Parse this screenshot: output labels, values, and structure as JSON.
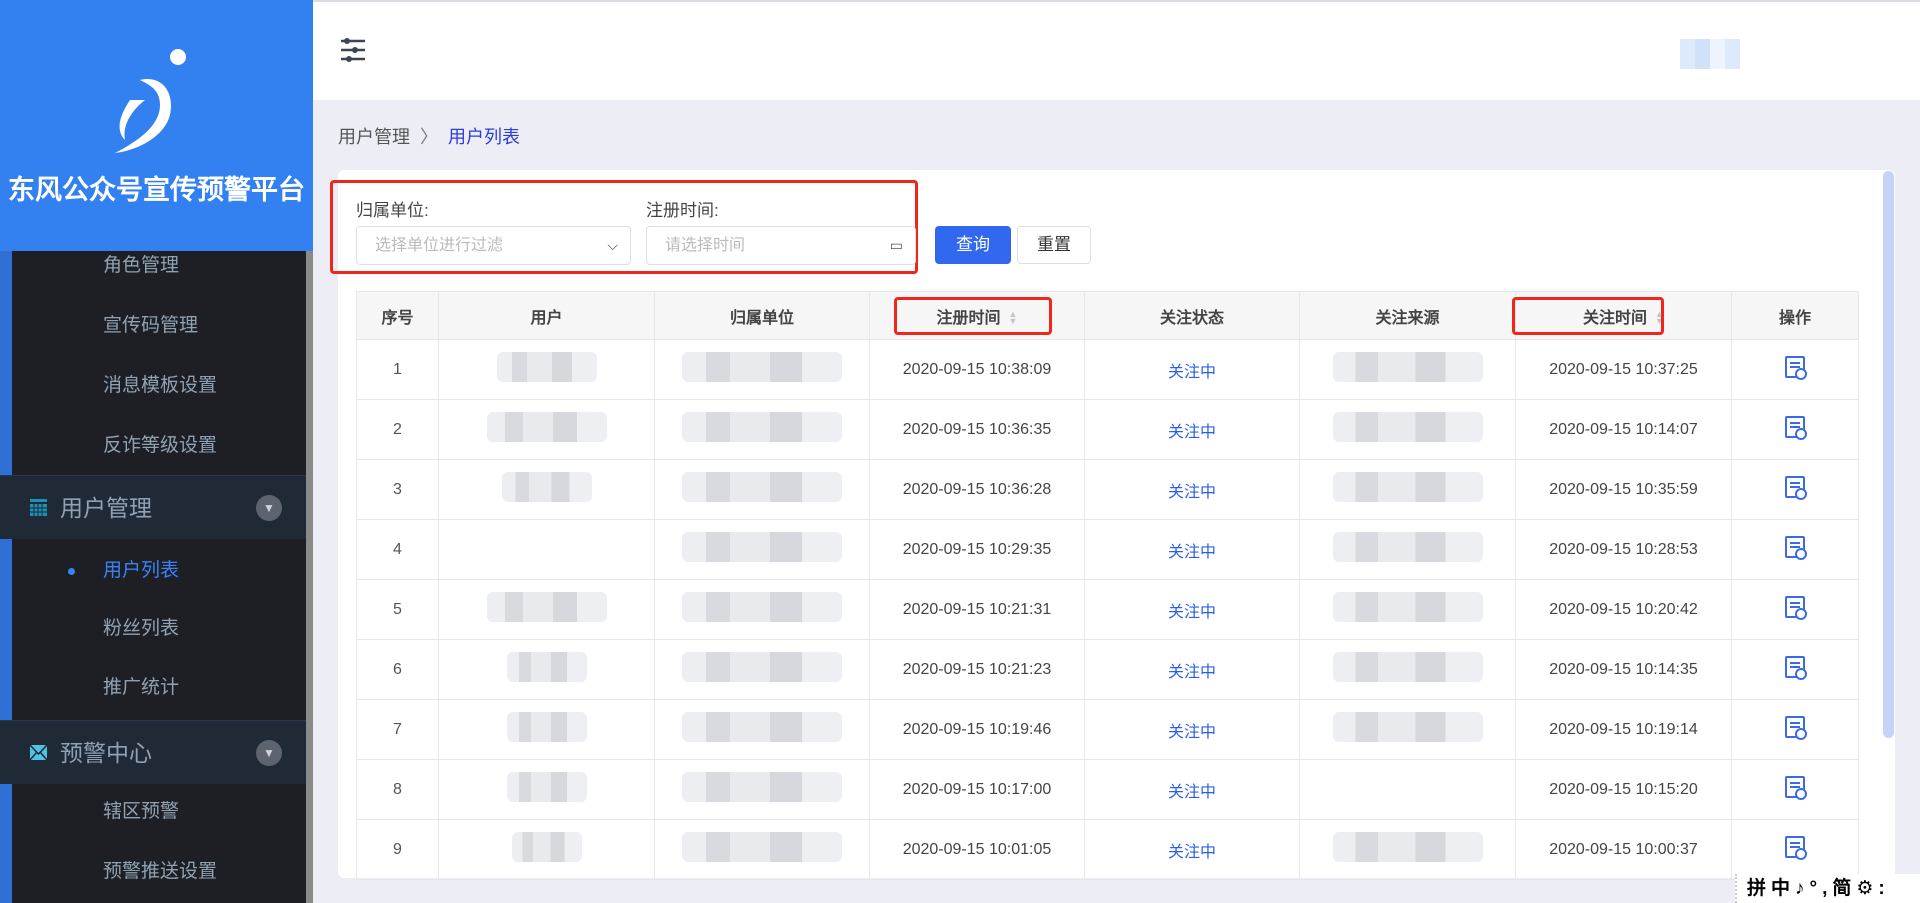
{
  "app": {
    "title": "东风公众号宣传预警平台"
  },
  "sidebar": {
    "items_top": [
      {
        "label": "角色管理"
      },
      {
        "label": "宣传码管理"
      },
      {
        "label": "消息模板设置"
      },
      {
        "label": "反诈等级设置"
      }
    ],
    "group_user": {
      "label": "用户管理",
      "icon": "calendar-icon",
      "items": [
        {
          "label": "用户列表",
          "active": true
        },
        {
          "label": "粉丝列表"
        },
        {
          "label": "推广统计"
        }
      ]
    },
    "group_alert": {
      "label": "预警中心",
      "icon": "mail-icon",
      "items": [
        {
          "label": "辖区预警"
        },
        {
          "label": "预警推送设置"
        }
      ]
    }
  },
  "breadcrumb": {
    "parent": "用户管理",
    "current": "用户列表"
  },
  "filters": {
    "unit_label": "归属单位:",
    "unit_placeholder": "选择单位进行过滤",
    "time_label": "注册时间:",
    "time_placeholder": "请选择时间",
    "query": "查询",
    "reset": "重置"
  },
  "table": {
    "headers": [
      "序号",
      "用户",
      "归属单位",
      "注册时间",
      "关注状态",
      "关注来源",
      "关注时间",
      "操作"
    ],
    "rows": [
      {
        "no": "1",
        "reg": "2020-09-15 10:38:09",
        "status": "关注中",
        "follow": "2020-09-15 10:37:25"
      },
      {
        "no": "2",
        "reg": "2020-09-15 10:36:35",
        "status": "关注中",
        "follow": "2020-09-15 10:14:07"
      },
      {
        "no": "3",
        "reg": "2020-09-15 10:36:28",
        "status": "关注中",
        "follow": "2020-09-15 10:35:59"
      },
      {
        "no": "4",
        "reg": "2020-09-15 10:29:35",
        "status": "关注中",
        "follow": "2020-09-15 10:28:53"
      },
      {
        "no": "5",
        "reg": "2020-09-15 10:21:31",
        "status": "关注中",
        "follow": "2020-09-15 10:20:42"
      },
      {
        "no": "6",
        "reg": "2020-09-15 10:21:23",
        "status": "关注中",
        "follow": "2020-09-15 10:14:35"
      },
      {
        "no": "7",
        "reg": "2020-09-15 10:19:46",
        "status": "关注中",
        "follow": "2020-09-15 10:19:14"
      },
      {
        "no": "8",
        "reg": "2020-09-15 10:17:00",
        "status": "关注中",
        "follow": "2020-09-15 10:15:20"
      },
      {
        "no": "9",
        "reg": "2020-09-15 10:01:05",
        "status": "关注中",
        "follow": "2020-09-15 10:00:37"
      }
    ]
  },
  "ime": {
    "text": "拼中♪°,简⚙:"
  },
  "colors": {
    "primary": "#3381f1",
    "sidebar": "#1e1f24",
    "highlight": "#f0261b"
  }
}
